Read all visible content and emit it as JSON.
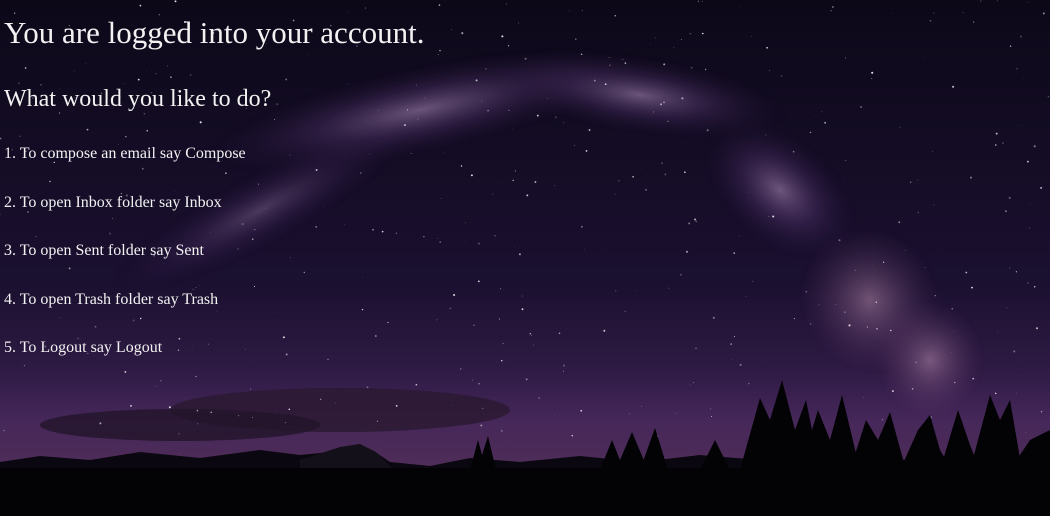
{
  "page": {
    "heading": "You are logged into your account.",
    "subheading": "What would you like to do?",
    "options": [
      {
        "label": "1. To compose an email say Compose"
      },
      {
        "label": "2. To open Inbox folder say Inbox"
      },
      {
        "label": "3. To open Sent folder say Sent"
      },
      {
        "label": "4. To open Trash folder say Trash"
      },
      {
        "label": "5. To Logout say Logout"
      }
    ]
  },
  "background": {
    "sky_top": "#0c0818",
    "sky_mid": "#201338",
    "horizon": "#4b2a62",
    "milky_way": "#b58ac8",
    "silhouette": "#050308"
  }
}
